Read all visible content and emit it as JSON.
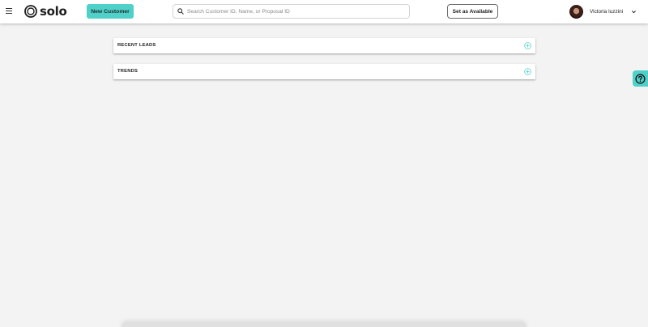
{
  "header": {
    "logo_text": "solo",
    "new_customer_label": "New Customer",
    "search_placeholder": "Search Customer ID, Name, or Proposal ID",
    "availability_label": "Set as Available",
    "user_name": "Victoria Iuzzini"
  },
  "panels": [
    {
      "title": "RECENT LEADS",
      "icon": "plus-circle-icon"
    },
    {
      "title": "TRENDS",
      "icon": "plus-circle-icon"
    }
  ],
  "help": {
    "icon": "question-circle-icon"
  },
  "colors": {
    "accent": "#4fd0c9",
    "background": "#f3f3f3",
    "panel": "#ffffff"
  }
}
